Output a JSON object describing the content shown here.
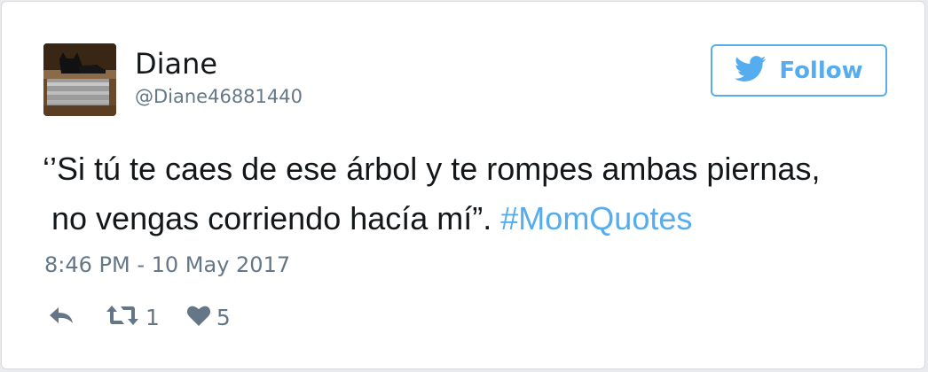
{
  "author": {
    "display_name": "Diane",
    "handle": "@Diane46881440",
    "avatar_icon": "cat-photo-avatar"
  },
  "follow_button": {
    "label": "Follow",
    "icon": "twitter-bird-icon",
    "accent_color": "#55acee"
  },
  "tweet": {
    "line1": "‘’Si tú te caes de ese árbol y te rompes ambas piernas,",
    "line2_text": "no vengas corriendo hacía mí”. ",
    "hashtag": "#MomQuotes",
    "timestamp": "8:46 PM - 10 May 2017"
  },
  "actions": {
    "reply_icon": "reply-icon",
    "retweet_icon": "retweet-icon",
    "retweet_count": "1",
    "like_icon": "heart-icon",
    "like_count": "5"
  },
  "colors": {
    "text": "#14171a",
    "muted": "#657786",
    "link": "#55acee"
  }
}
